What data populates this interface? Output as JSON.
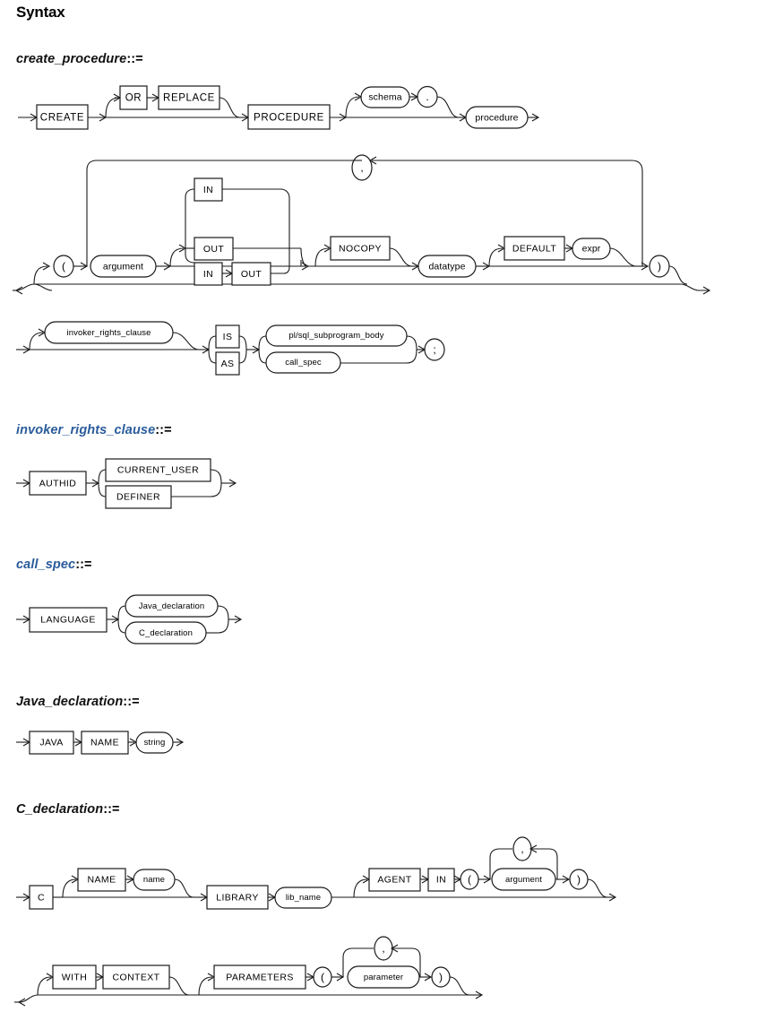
{
  "page": {
    "section_title": "Syntax",
    "heading_color_blue": "#2B5C9B",
    "heading_color_black": "#111111",
    "line_color": "#1a1a1a"
  },
  "rules": [
    {
      "id": "create_procedure",
      "name": "create_procedure",
      "operator": "::=",
      "color": "black",
      "tokens": {
        "create": "CREATE",
        "or": "OR",
        "replace": "REPLACE",
        "procedure_kw": "PROCEDURE",
        "schema": "schema",
        "dot": ".",
        "procedure": "procedure",
        "comma": ",",
        "lparen": "(",
        "rparen": ")",
        "argument": "argument",
        "in": "IN",
        "out": "OUT",
        "in2": "IN",
        "out2": "OUT",
        "nocopy": "NOCOPY",
        "datatype": "datatype",
        "default": "DEFAULT",
        "expr": "expr",
        "invoker_rights_clause": "invoker_rights_clause",
        "is": "IS",
        "as": "AS",
        "plsql_subprogram_body": "pl/sql_subprogram_body",
        "call_spec": "call_spec",
        "semicolon": ";"
      }
    },
    {
      "id": "invoker_rights_clause",
      "name": "invoker_rights_clause",
      "operator": "::=",
      "color": "blue",
      "tokens": {
        "authid": "AUTHID",
        "current_user": "CURRENT_USER",
        "definer": "DEFINER"
      }
    },
    {
      "id": "call_spec",
      "name": "call_spec",
      "operator": "::=",
      "color": "blue",
      "tokens": {
        "language": "LANGUAGE",
        "java_declaration": "Java_declaration",
        "c_declaration": "C_declaration"
      }
    },
    {
      "id": "Java_declaration",
      "name": "Java_declaration",
      "operator": "::=",
      "color": "black",
      "tokens": {
        "java": "JAVA",
        "name_kw": "NAME",
        "string": "string"
      }
    },
    {
      "id": "C_declaration",
      "name": "C_declaration",
      "operator": "::=",
      "color": "black",
      "tokens": {
        "c": "C",
        "name_kw": "NAME",
        "name": "name",
        "library": "LIBRARY",
        "lib_name": "lib_name",
        "agent": "AGENT",
        "in": "IN",
        "lparen": "(",
        "argument": "argument",
        "comma": ",",
        "rparen": ")",
        "with": "WITH",
        "context": "CONTEXT",
        "parameters": "PARAMETERS",
        "lparen2": "(",
        "parameter": "parameter",
        "comma2": ",",
        "rparen2": ")"
      }
    }
  ]
}
